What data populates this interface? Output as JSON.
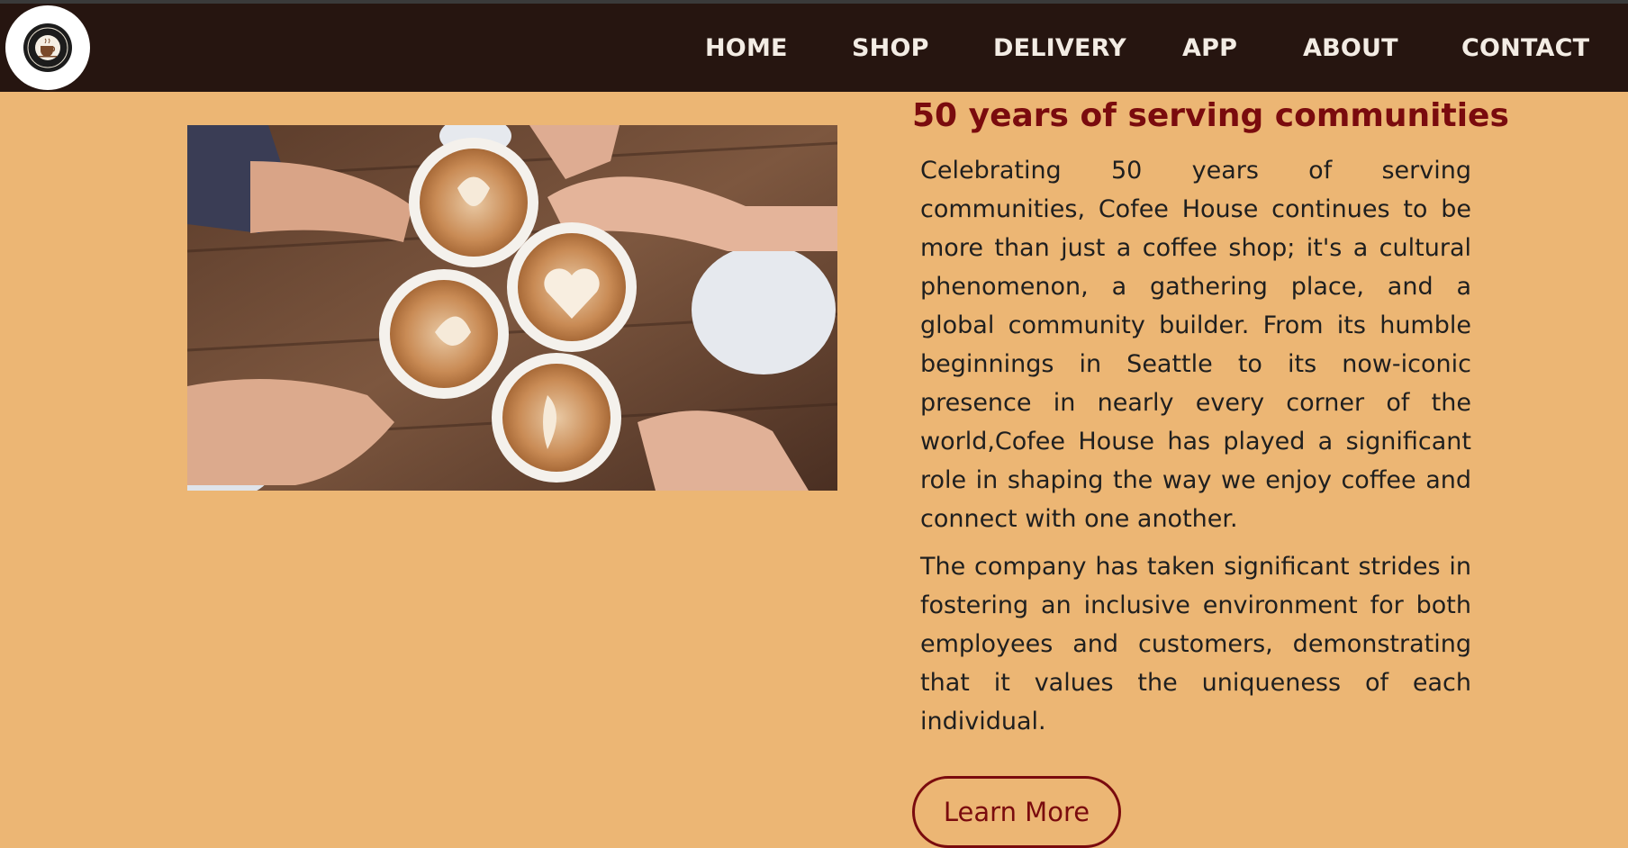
{
  "nav": {
    "logo_alt": "Coffee Shop logo",
    "items": [
      {
        "label": "HOME"
      },
      {
        "label": "SHOP"
      },
      {
        "label": "DELIVERY"
      },
      {
        "label": "APP"
      },
      {
        "label": "ABOUT"
      },
      {
        "label": "CONTACT"
      }
    ]
  },
  "hero": {
    "image_icon": "coffee-cups-photo",
    "headline": "50 years of serving communities",
    "paragraph1": "Celebrating 50 years of serving communities, Cofee House continues to be more than just a coffee shop; it's a cultural phenomenon, a gathering place, and a global community builder. From its humble beginnings in Seattle to its now-iconic presence in nearly every corner of the world,Cofee House has played a significant role in shaping the way we enjoy coffee and connect with one another.",
    "paragraph2": "The company has taken significant strides in fostering an inclusive environment for both employees and customers, demonstrating that it values the uniqueness of each individual.",
    "button_label": "Learn More"
  },
  "colors": {
    "background": "#ecb674",
    "navbar": "#261510",
    "accent": "#7a0b0e",
    "nav_text": "#f3ece4"
  }
}
